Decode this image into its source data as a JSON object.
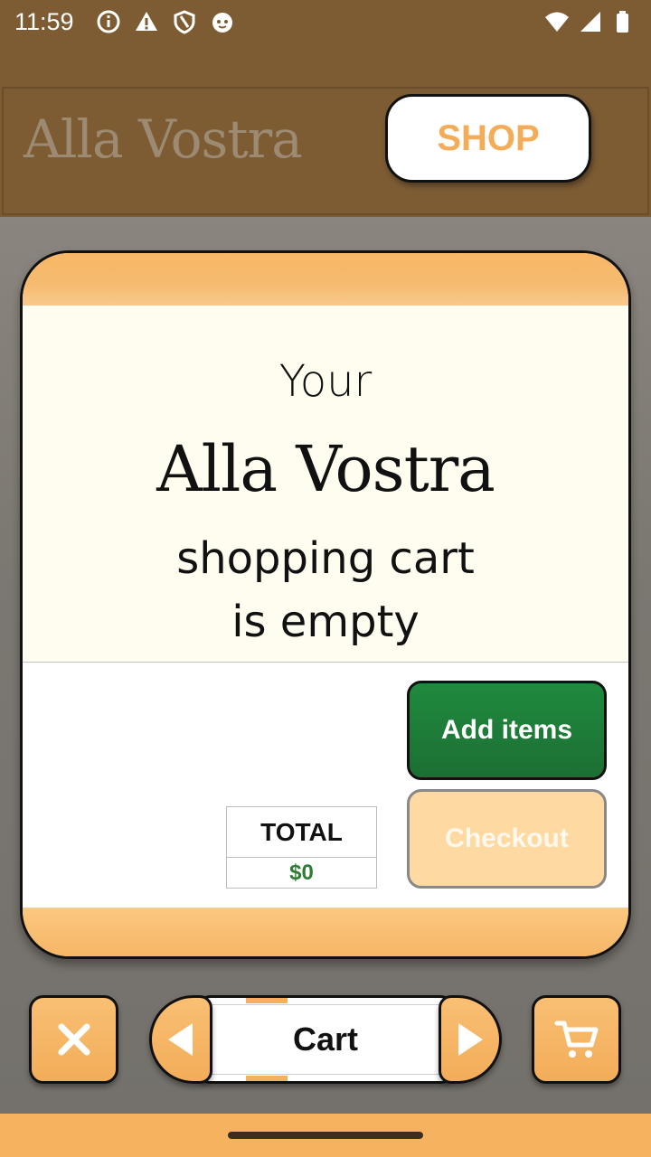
{
  "status_bar": {
    "time": "11:59",
    "left_icons": [
      "info-icon",
      "warning-icon",
      "shield-icon",
      "cat-icon"
    ],
    "right_icons": [
      "wifi-icon",
      "signal-icon",
      "battery-icon"
    ]
  },
  "header": {
    "brand": "Alla Vostra",
    "shop_label": "SHOP"
  },
  "cart_modal": {
    "line_your": "Your",
    "line_brand": "Alla Vostra",
    "line_cart": "shopping cart",
    "line_empty": "is empty",
    "total_label": "TOTAL",
    "total_value": "$0",
    "add_items_label": "Add items",
    "checkout_label": "Checkout"
  },
  "toolbar": {
    "close_icon": "close-icon",
    "prev_icon": "arrow-left-icon",
    "current_label": "Cart",
    "next_icon": "arrow-right-icon",
    "cart_icon": "cart-icon"
  },
  "colors": {
    "header_bg": "#7d5c34",
    "accent_orange": "#f5b25f",
    "add_green": "#1f7a38",
    "total_green": "#2e7d32",
    "checkout_disabled": "#fed9a2"
  }
}
